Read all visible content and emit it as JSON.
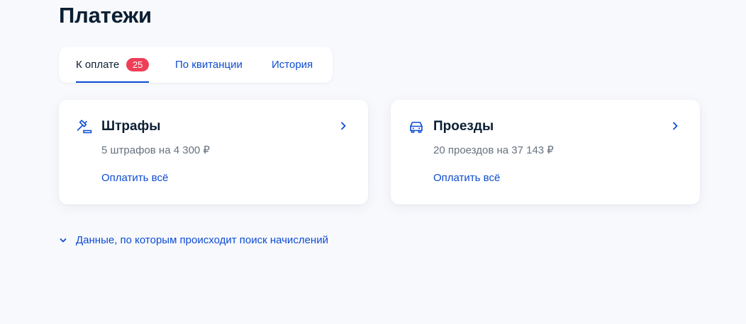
{
  "page": {
    "title": "Платежи"
  },
  "tabs": [
    {
      "label": "К оплате",
      "badge": "25",
      "active": true
    },
    {
      "label": "По квитанции",
      "active": false
    },
    {
      "label": "История",
      "active": false
    }
  ],
  "cards": [
    {
      "icon": "gavel-icon",
      "title": "Штрафы",
      "subtitle": "5 штрафов на 4 300 ₽",
      "action": "Оплатить всё"
    },
    {
      "icon": "car-icon",
      "title": "Проезды",
      "subtitle": "20 проездов на 37 143 ₽",
      "action": "Оплатить всё"
    }
  ],
  "search_data": {
    "label": "Данные, по которым происходит поиск начислений",
    "icon": "chevron-down-icon"
  },
  "colors": {
    "accent": "#0d4cd3",
    "badge": "#ee3f58",
    "text": "#0b1f33",
    "secondary_text": "#66727f",
    "background": "#f8f9fd"
  }
}
